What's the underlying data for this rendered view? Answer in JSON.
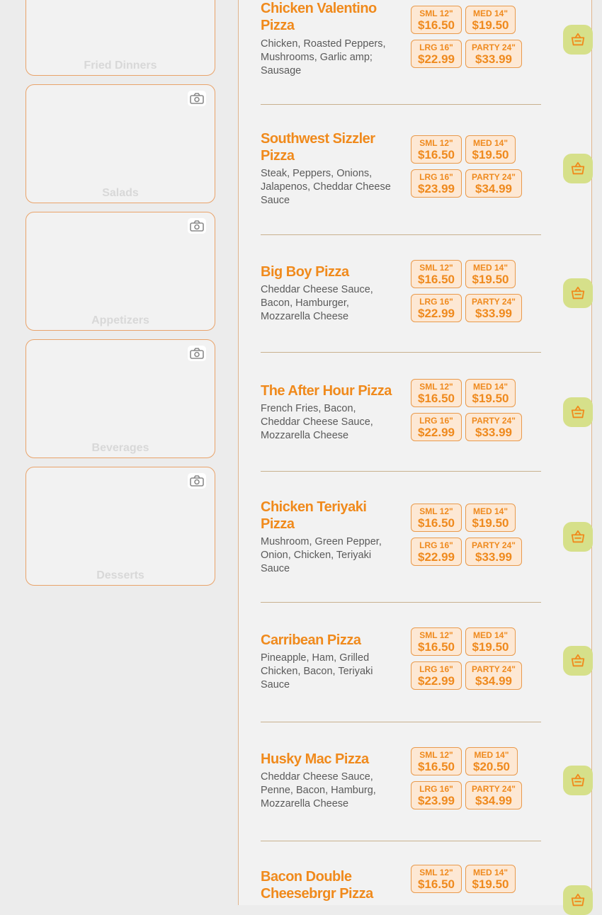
{
  "categories": [
    {
      "label": "Fried Dinners",
      "icon": "camera-icon"
    },
    {
      "label": "Salads",
      "icon": "camera-icon"
    },
    {
      "label": "Appetizers",
      "icon": "camera-icon"
    },
    {
      "label": "Beverages",
      "icon": "camera-icon"
    },
    {
      "label": "Desserts",
      "icon": "camera-icon"
    }
  ],
  "items": [
    {
      "name": "Chicken Valentino Pizza",
      "desc": "Chicken, Roasted Peppers, Mushrooms, Garlic amp; Sausage",
      "sizes": [
        {
          "size": "SML 12\"",
          "price": "$16.50"
        },
        {
          "size": "MED 14\"",
          "price": "$19.50"
        },
        {
          "size": "LRG 16\"",
          "price": "$22.99"
        },
        {
          "size": "PARTY 24\"",
          "price": "$33.99"
        }
      ]
    },
    {
      "name": "Southwest Sizzler Pizza",
      "desc": "Steak, Peppers, Onions, Jalapenos, Cheddar Cheese Sauce",
      "sizes": [
        {
          "size": "SML 12\"",
          "price": "$16.50"
        },
        {
          "size": "MED 14\"",
          "price": "$19.50"
        },
        {
          "size": "LRG 16\"",
          "price": "$23.99"
        },
        {
          "size": "PARTY 24\"",
          "price": "$34.99"
        }
      ]
    },
    {
      "name": "Big Boy Pizza",
      "desc": "Cheddar Cheese Sauce, Bacon, Hamburger, Mozzarella Cheese",
      "sizes": [
        {
          "size": "SML 12\"",
          "price": "$16.50"
        },
        {
          "size": "MED 14\"",
          "price": "$19.50"
        },
        {
          "size": "LRG 16\"",
          "price": "$22.99"
        },
        {
          "size": "PARTY 24\"",
          "price": "$33.99"
        }
      ]
    },
    {
      "name": "The After Hour Pizza",
      "desc": "French Fries, Bacon, Cheddar Cheese Sauce, Mozzarella Cheese",
      "sizes": [
        {
          "size": "SML 12\"",
          "price": "$16.50"
        },
        {
          "size": "MED 14\"",
          "price": "$19.50"
        },
        {
          "size": "LRG 16\"",
          "price": "$22.99"
        },
        {
          "size": "PARTY 24\"",
          "price": "$33.99"
        }
      ]
    },
    {
      "name": "Chicken Teriyaki Pizza",
      "desc": "Mushroom, Green Pepper, Onion, Chicken, Teriyaki Sauce",
      "sizes": [
        {
          "size": "SML 12\"",
          "price": "$16.50"
        },
        {
          "size": "MED 14\"",
          "price": "$19.50"
        },
        {
          "size": "LRG 16\"",
          "price": "$22.99"
        },
        {
          "size": "PARTY 24\"",
          "price": "$33.99"
        }
      ]
    },
    {
      "name": "Carribean Pizza",
      "desc": "Pineapple, Ham, Grilled Chicken, Bacon, Teriyaki Sauce",
      "sizes": [
        {
          "size": "SML 12\"",
          "price": "$16.50"
        },
        {
          "size": "MED 14\"",
          "price": "$19.50"
        },
        {
          "size": "LRG 16\"",
          "price": "$22.99"
        },
        {
          "size": "PARTY 24\"",
          "price": "$34.99"
        }
      ]
    },
    {
      "name": "Husky Mac Pizza",
      "desc": "Cheddar Cheese Sauce, Penne, Bacon, Hamburg, Mozzarella Cheese",
      "sizes": [
        {
          "size": "SML 12\"",
          "price": "$16.50"
        },
        {
          "size": "MED 14\"",
          "price": "$20.50"
        },
        {
          "size": "LRG 16\"",
          "price": "$23.99"
        },
        {
          "size": "PARTY 24\"",
          "price": "$34.99"
        }
      ]
    },
    {
      "name": "Bacon Double Cheesebrgr Pizza",
      "desc": "",
      "sizes": [
        {
          "size": "SML 12\"",
          "price": "$16.50"
        },
        {
          "size": "MED 14\"",
          "price": "$19.50"
        }
      ]
    }
  ],
  "colors": {
    "accent": "#f08a1c",
    "price_bg": "#fde8d4",
    "cart_bg": "#d6e08a",
    "card_border": "#e9a36a"
  }
}
